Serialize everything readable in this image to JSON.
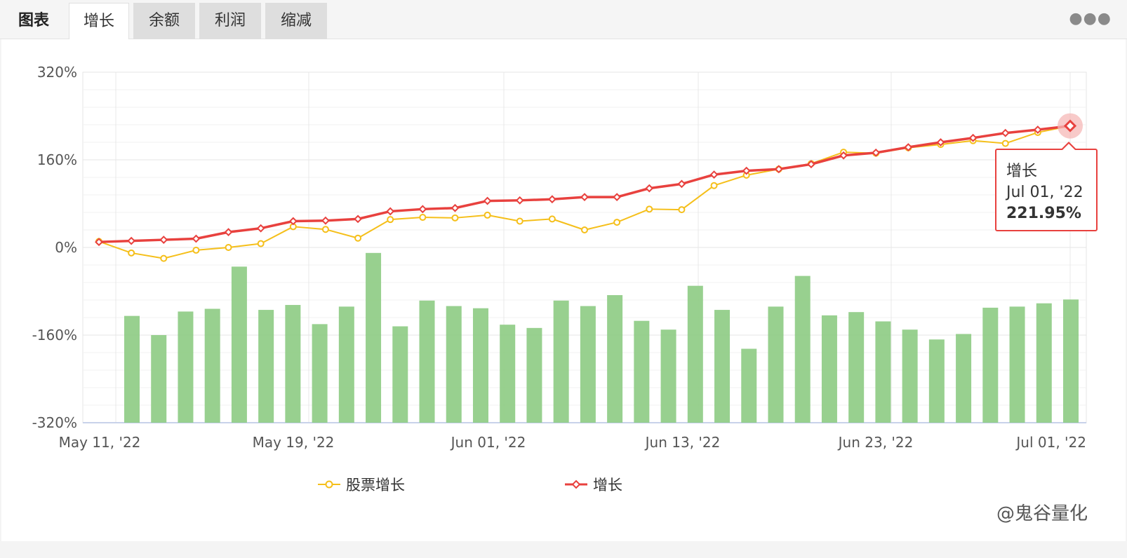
{
  "tabs": {
    "title": "图表",
    "items": [
      "增长",
      "余额",
      "利润",
      "缩减"
    ],
    "active": 0
  },
  "more_icon": "more-horizontal-icon",
  "watermark": "@鬼谷量化",
  "tooltip": {
    "series": "增长",
    "date": "Jul 01, '22",
    "value": "221.95%"
  },
  "chart_data": {
    "type": "line",
    "ylim": [
      -320,
      320
    ],
    "yticks": [
      "320%",
      "160%",
      "0%",
      "-160%",
      "-320%"
    ],
    "ytick_values": [
      320,
      160,
      0,
      -160,
      -320
    ],
    "xticks": [
      "May 11, '22",
      "May 19, '22",
      "Jun 01, '22",
      "Jun 13, '22",
      "Jun 23, '22",
      "Jul 01, '22"
    ],
    "legend": [
      "股票增长",
      "增长"
    ],
    "legend_placement": "bottom-center",
    "grid": true,
    "colors": {
      "stock": "#f5bf1a",
      "growth": "#e8413e",
      "bars": "#8fcc86"
    },
    "series": [
      {
        "name": "股票增长",
        "type": "line",
        "values": [
          11,
          -10,
          -20,
          -5,
          0,
          7,
          38,
          33,
          17,
          51,
          55,
          54,
          59,
          48,
          52,
          32,
          46,
          70,
          69,
          113,
          132,
          143,
          153,
          174,
          172,
          182,
          188,
          195,
          190,
          210,
          222
        ]
      },
      {
        "name": "增长",
        "type": "line",
        "values": [
          10,
          12,
          14,
          16,
          28,
          35,
          48,
          49,
          52,
          66,
          70,
          72,
          85,
          86,
          88,
          92,
          92,
          108,
          116,
          133,
          140,
          143,
          152,
          168,
          173,
          183,
          192,
          200,
          209,
          215,
          222
        ]
      },
      {
        "name": "",
        "type": "bar",
        "values": [
          195,
          160,
          203,
          208,
          285,
          206,
          215,
          180,
          212,
          310,
          176,
          223,
          213,
          209,
          179,
          173,
          223,
          213,
          233,
          186,
          170,
          250,
          206,
          135,
          212,
          268,
          196,
          202,
          185,
          170,
          152,
          162,
          210,
          212,
          218,
          225
        ]
      }
    ]
  }
}
